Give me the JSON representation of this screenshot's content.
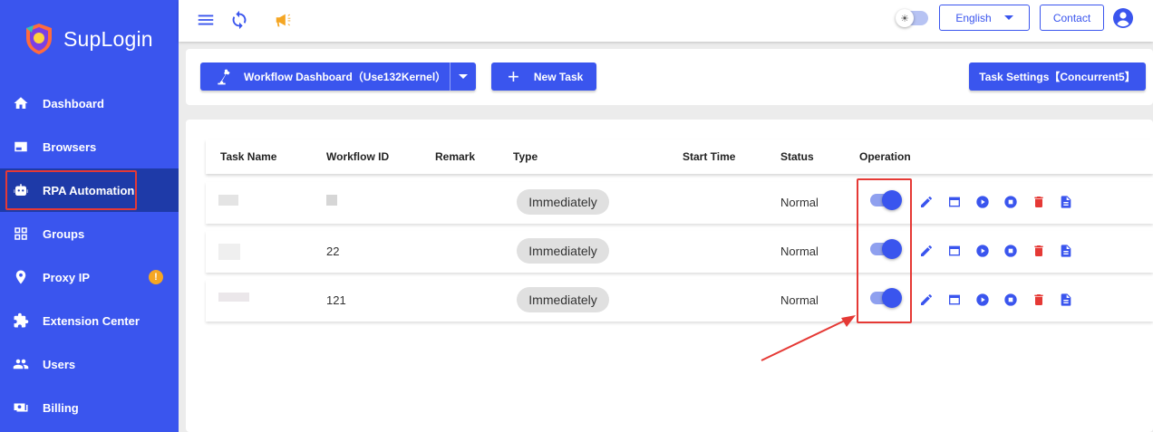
{
  "app": {
    "name": "SupLogin"
  },
  "sidebar": {
    "items": [
      {
        "label": "Dashboard",
        "icon": "home-icon"
      },
      {
        "label": "Browsers",
        "icon": "browser-window-icon"
      },
      {
        "label": "RPA Automation",
        "icon": "robot-icon",
        "active": true
      },
      {
        "label": "Groups",
        "icon": "grid-icon"
      },
      {
        "label": "Proxy IP",
        "icon": "location-pin-icon",
        "badge": "!"
      },
      {
        "label": "Extension Center",
        "icon": "puzzle-icon"
      },
      {
        "label": "Users",
        "icon": "users-icon"
      },
      {
        "label": "Billing",
        "icon": "billing-icon"
      }
    ]
  },
  "topbar": {
    "language": "English",
    "contact": "Contact",
    "icons": [
      "menu-icon",
      "refresh-icon",
      "megaphone-icon",
      "theme-toggle",
      "account-icon"
    ]
  },
  "toolbar": {
    "workflow_dashboard": "Workflow Dashboard（Use132Kernel）",
    "new_task": "New Task",
    "task_settings": "Task Settings【Concurrent5】"
  },
  "table": {
    "headers": {
      "task_name": "Task Name",
      "workflow_id": "Workflow ID",
      "remark": "Remark",
      "type": "Type",
      "start_time": "Start Time",
      "status": "Status",
      "operation": "Operation"
    },
    "rows": [
      {
        "workflow_id": "",
        "type": "Immediately",
        "status": "Normal",
        "enabled": true
      },
      {
        "workflow_id": "22",
        "type": "Immediately",
        "status": "Normal",
        "enabled": true
      },
      {
        "workflow_id": "121",
        "type": "Immediately",
        "status": "Normal",
        "enabled": true
      }
    ],
    "operation_icons": [
      "edit-icon",
      "window-icon",
      "play-icon",
      "stop-icon",
      "delete-icon",
      "log-icon"
    ]
  },
  "colors": {
    "primary": "#3a55ee",
    "sidebar_active": "#1e3aa8",
    "danger": "#e53935",
    "warning": "#f5a623",
    "annotation": "#e53935"
  }
}
